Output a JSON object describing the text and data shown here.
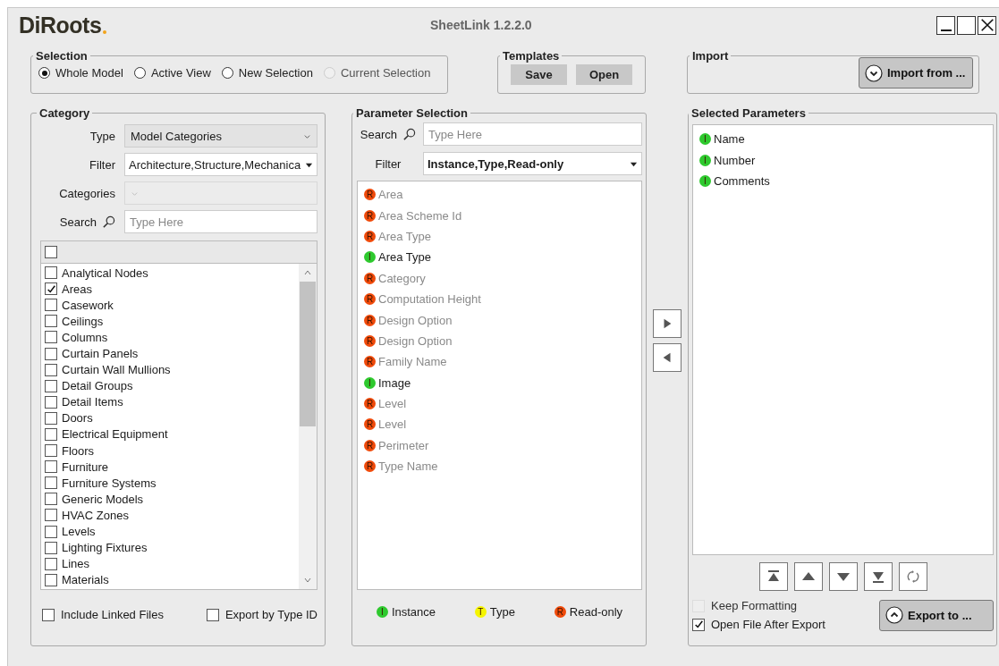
{
  "window": {
    "logo": "DiRoots",
    "title": "SheetLink 1.2.2.0"
  },
  "selection": {
    "title": "Selection",
    "options": [
      {
        "label": "Whole Model",
        "selected": true,
        "disabled": false
      },
      {
        "label": "Active View",
        "selected": false,
        "disabled": false
      },
      {
        "label": "New Selection",
        "selected": false,
        "disabled": false
      },
      {
        "label": "Current Selection",
        "selected": false,
        "disabled": true
      }
    ]
  },
  "templates": {
    "title": "Templates",
    "buttons": [
      "Save",
      "Open"
    ]
  },
  "import": {
    "title": "Import",
    "button": "Import from ..."
  },
  "category": {
    "title": "Category",
    "type": {
      "label": "Type",
      "value": "Model Categories"
    },
    "filter": {
      "label": "Filter",
      "value": "Architecture,Structure,Mechanica"
    },
    "categories": {
      "label": "Categories",
      "disabled": true
    },
    "search": {
      "label": "Search",
      "placeholder": "Type Here"
    },
    "select_all": {
      "checked": false
    },
    "items": [
      {
        "label": "Analytical Nodes",
        "checked": false
      },
      {
        "label": "Areas",
        "checked": true
      },
      {
        "label": "Casework",
        "checked": false
      },
      {
        "label": "Ceilings",
        "checked": false
      },
      {
        "label": "Columns",
        "checked": false
      },
      {
        "label": "Curtain Panels",
        "checked": false
      },
      {
        "label": "Curtain Wall Mullions",
        "checked": false
      },
      {
        "label": "Detail Groups",
        "checked": false
      },
      {
        "label": "Detail Items",
        "checked": false
      },
      {
        "label": "Doors",
        "checked": false
      },
      {
        "label": "Electrical Equipment",
        "checked": false
      },
      {
        "label": "Floors",
        "checked": false
      },
      {
        "label": "Furniture",
        "checked": false
      },
      {
        "label": "Furniture Systems",
        "checked": false
      },
      {
        "label": "Generic Models",
        "checked": false
      },
      {
        "label": "HVAC Zones",
        "checked": false
      },
      {
        "label": "Levels",
        "checked": false
      },
      {
        "label": "Lighting Fixtures",
        "checked": false
      },
      {
        "label": "Lines",
        "checked": false
      },
      {
        "label": "Materials",
        "checked": false
      }
    ],
    "include_linked_files": {
      "label": "Include Linked Files",
      "checked": false
    },
    "export_by_type_id": {
      "label": "Export by Type ID",
      "checked": false
    }
  },
  "parameter_selection": {
    "title": "Parameter Selection",
    "search": {
      "label": "Search",
      "placeholder": "Type Here"
    },
    "filter": {
      "label": "Filter",
      "value": "Instance,Type,Read-only"
    },
    "items": [
      {
        "badge": "R",
        "color": "#f04a0a",
        "label": "Area",
        "disabled": true
      },
      {
        "badge": "R",
        "color": "#f04a0a",
        "label": "Area Scheme Id",
        "disabled": true
      },
      {
        "badge": "R",
        "color": "#f04a0a",
        "label": "Area Type",
        "disabled": true
      },
      {
        "badge": "I",
        "color": "#2ec92e",
        "label": "Area Type",
        "disabled": false
      },
      {
        "badge": "R",
        "color": "#f04a0a",
        "label": "Category",
        "disabled": true
      },
      {
        "badge": "R",
        "color": "#f04a0a",
        "label": "Computation Height",
        "disabled": true
      },
      {
        "badge": "R",
        "color": "#f04a0a",
        "label": "Design Option",
        "disabled": true
      },
      {
        "badge": "R",
        "color": "#f04a0a",
        "label": "Design Option",
        "disabled": true
      },
      {
        "badge": "R",
        "color": "#f04a0a",
        "label": "Family Name",
        "disabled": true
      },
      {
        "badge": "I",
        "color": "#2ec92e",
        "label": "Image",
        "disabled": false
      },
      {
        "badge": "R",
        "color": "#f04a0a",
        "label": "Level",
        "disabled": true
      },
      {
        "badge": "R",
        "color": "#f04a0a",
        "label": "Level",
        "disabled": true
      },
      {
        "badge": "R",
        "color": "#f04a0a",
        "label": "Perimeter",
        "disabled": true
      },
      {
        "badge": "R",
        "color": "#f04a0a",
        "label": "Type Name",
        "disabled": true
      }
    ],
    "legend": [
      {
        "badge": "I",
        "color": "#2ec92e",
        "label": "Instance"
      },
      {
        "badge": "T",
        "color": "#f5f500",
        "label": "Type"
      },
      {
        "badge": "R",
        "color": "#f04a0a",
        "label": "Read-only"
      }
    ]
  },
  "selected_parameters": {
    "title": "Selected Parameters",
    "items": [
      {
        "badge": "I",
        "color": "#2ec92e",
        "label": "Name"
      },
      {
        "badge": "I",
        "color": "#2ec92e",
        "label": "Number"
      },
      {
        "badge": "I",
        "color": "#2ec92e",
        "label": "Comments"
      }
    ],
    "keep_formatting": {
      "label": "Keep Formatting",
      "checked": false,
      "disabled": true
    },
    "open_file_after_export": {
      "label": "Open File After Export",
      "checked": true,
      "disabled": false
    },
    "export_button": "Export to ..."
  }
}
